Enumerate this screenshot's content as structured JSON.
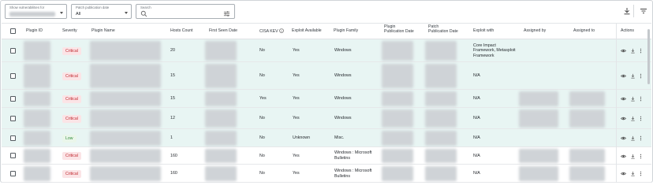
{
  "filters": {
    "show_vulns": {
      "label": "Show vulnerabilities for",
      "value": ""
    },
    "patch_date": {
      "label": "Patch publication date",
      "value": "All"
    },
    "search": {
      "label": "Search",
      "placeholder": ""
    }
  },
  "toolbar": {
    "download_icon": "download-icon",
    "filter_icon": "filter-icon"
  },
  "columns": {
    "plugin_id": "Plugin ID",
    "severity": "Severity",
    "plugin_name": "Plugin Name",
    "hosts_count": "Hosts Count",
    "first_seen": "First Seen Date",
    "cisa_kev": "CISA KEV",
    "exploit_available": "Exploit Available",
    "plugin_family": "Plugin Family",
    "plugin_pub_date_1": "Plugin",
    "plugin_pub_date_2": "Publication Date",
    "patch_pub_date_1": "Patch",
    "patch_pub_date_2": "Publication Date",
    "exploit_with": "Exploit with",
    "assigned_by": "Assigned by",
    "assigned_to": "Assigned to",
    "actions": "Actions"
  },
  "rows": [
    {
      "severity": "Critical",
      "hosts": "20",
      "kev": "No",
      "exploit": "Yes",
      "family_1": "Windows",
      "family_2": "",
      "exploit_with_1": "Core Impact",
      "exploit_with_2": "Framework, Metasploit",
      "exploit_with_3": "Framework",
      "highlight": true
    },
    {
      "severity": "Critical",
      "hosts": "15",
      "kev": "No",
      "exploit": "Yes",
      "family_1": "Windows",
      "family_2": "",
      "exploit_with_1": "N/A",
      "exploit_with_2": "",
      "exploit_with_3": "",
      "highlight": true
    },
    {
      "severity": "Critical",
      "hosts": "15",
      "kev": "Yes",
      "exploit": "Yes",
      "family_1": "Windows",
      "family_2": "",
      "exploit_with_1": "N/A",
      "exploit_with_2": "",
      "exploit_with_3": "",
      "highlight": true
    },
    {
      "severity": "Critical",
      "hosts": "12",
      "kev": "No",
      "exploit": "Yes",
      "family_1": "Windows",
      "family_2": "",
      "exploit_with_1": "N/A",
      "exploit_with_2": "",
      "exploit_with_3": "",
      "highlight": true
    },
    {
      "severity": "Low",
      "hosts": "1",
      "kev": "No",
      "exploit": "Unknown",
      "family_1": "Misc.",
      "family_2": "",
      "exploit_with_1": "N/A",
      "exploit_with_2": "",
      "exploit_with_3": "",
      "highlight": true
    },
    {
      "severity": "Critical",
      "hosts": "160",
      "kev": "No",
      "exploit": "Yes",
      "family_1": "Windows : Microsoft",
      "family_2": "Bulletins",
      "exploit_with_1": "N/A",
      "exploit_with_2": "",
      "exploit_with_3": "",
      "highlight": false
    },
    {
      "severity": "Critical",
      "hosts": "160",
      "kev": "No",
      "exploit": "Yes",
      "family_1": "Windows : Microsoft",
      "family_2": "Bulletins",
      "exploit_with_1": "N/A",
      "exploit_with_2": "",
      "exploit_with_3": "",
      "highlight": false
    }
  ],
  "row_actions": {
    "view": "eye-icon",
    "download": "download-icon",
    "more": "more-vertical-icon"
  }
}
